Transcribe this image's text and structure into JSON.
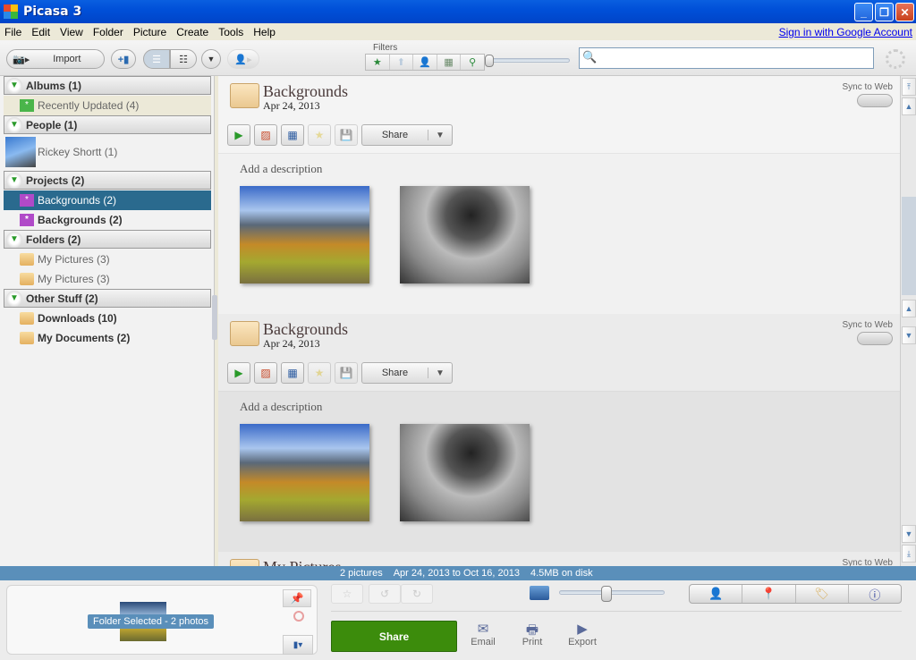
{
  "window": {
    "title": "Picasa 3",
    "buttons": [
      "minimize",
      "restore",
      "close"
    ]
  },
  "menu": {
    "items": [
      "File",
      "Edit",
      "View",
      "Folder",
      "Picture",
      "Create",
      "Tools",
      "Help"
    ],
    "signin": "Sign in with Google Account"
  },
  "toolbar": {
    "import_label": "Import",
    "filters_label": "Filters",
    "filters": [
      "star-filter",
      "upload-filter",
      "people-filter",
      "movie-filter",
      "geotag-filter"
    ],
    "search_placeholder": ""
  },
  "sidebar": {
    "sections": [
      {
        "label": "Albums (1)",
        "items": [
          {
            "label": "Recently Updated (4)",
            "icon": "album-icon"
          }
        ]
      },
      {
        "label": "People (1)",
        "items": [
          {
            "label": "Rickey Shortt (1)",
            "icon": "person-thumbnail"
          }
        ]
      },
      {
        "label": "Projects (2)",
        "items": [
          {
            "label": "Backgrounds (2)",
            "icon": "project-icon",
            "selected": true
          },
          {
            "label": "Backgrounds (2)",
            "icon": "project-icon"
          }
        ]
      },
      {
        "label": "Folders (2)",
        "items": [
          {
            "label": "My Pictures (3)",
            "icon": "folder-icon"
          },
          {
            "label": "My Pictures (3)",
            "icon": "folder-icon"
          }
        ]
      },
      {
        "label": "Other Stuff (2)",
        "items": [
          {
            "label": "Downloads (10)",
            "icon": "folder-icon"
          },
          {
            "label": "My Documents (2)",
            "icon": "folder-icon"
          }
        ]
      }
    ]
  },
  "groups": [
    {
      "title": "Backgrounds",
      "date": "Apr 24, 2013",
      "sync": "Sync to Web",
      "share": "Share",
      "description": "Add a description",
      "photos": [
        "mountain-landscape",
        "volcano-eruption"
      ]
    },
    {
      "title": "Backgrounds",
      "date": "Apr 24, 2013",
      "sync": "Sync to Web",
      "share": "Share",
      "description": "Add a description",
      "photos": [
        "mountain-landscape",
        "volcano-eruption"
      ]
    },
    {
      "title": "My Pictures",
      "sync": "Sync to Web"
    }
  ],
  "status": {
    "count": "2 pictures",
    "range": "Apr 24, 2013 to Oct 16, 2013",
    "size": "4.5MB on disk"
  },
  "tray": {
    "label": "Folder Selected - 2 photos"
  },
  "bottom": {
    "share_label": "Share",
    "actions": [
      "Email",
      "Print",
      "Export"
    ],
    "thumb_size": 0.45
  }
}
